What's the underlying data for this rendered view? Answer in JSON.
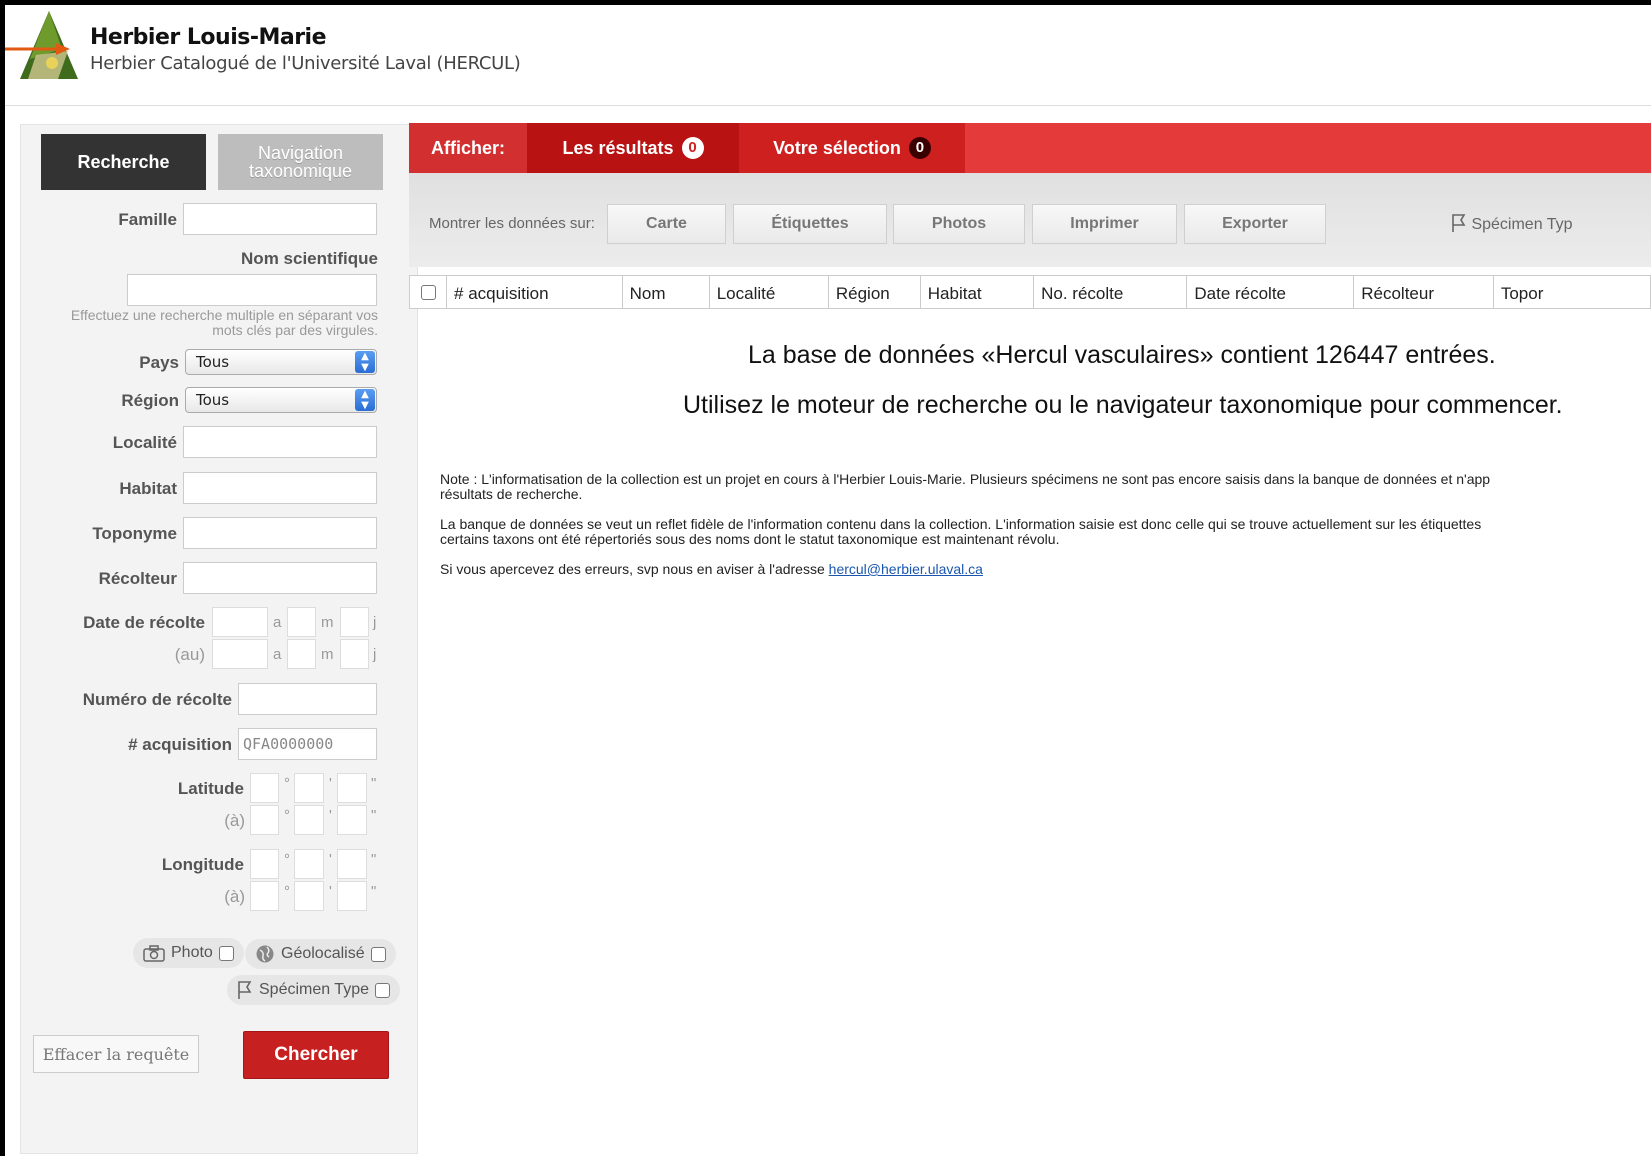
{
  "header": {
    "title": "Herbier Louis-Marie",
    "subtitle": "Herbier Catalogué de l'Université Laval (HERCUL)"
  },
  "sidebar": {
    "tab_search": "Recherche",
    "tab_nav_line1": "Navigation",
    "tab_nav_line2": "taxonomique",
    "famille": "Famille",
    "nom_scientifique": "Nom scientifique",
    "hint_line1": "Effectuez une recherche multiple en séparant vos",
    "hint_line2": "mots clés par des virgules.",
    "pays": "Pays",
    "pays_value": "Tous",
    "region": "Région",
    "region_value": "Tous",
    "localite": "Localité",
    "habitat": "Habitat",
    "toponyme": "Toponyme",
    "recolteur": "Récolteur",
    "date_recolte": "Date de récolte",
    "au": "(au)",
    "unit_a": "a",
    "unit_m": "m",
    "unit_j": "j",
    "numero_recolte": "Numéro de récolte",
    "acquisition": "# acquisition",
    "acquisition_placeholder": "QFA0000000",
    "latitude": "Latitude",
    "longitude": "Longitude",
    "a_accent": "(à)",
    "deg": "°",
    "min": "'",
    "sec": "\"",
    "photo": "Photo",
    "geolocalise": "Géolocalisé",
    "specimen_type": "Spécimen Type",
    "clear_button": "Effacer la requête",
    "search_button": "Chercher"
  },
  "results": {
    "afficher": "Afficher:",
    "tab_results": "Les résultats",
    "tab_results_count": "0",
    "tab_selection": "Votre sélection",
    "tab_selection_count": "0",
    "show_data_on": "Montrer les données sur:",
    "buttons": [
      "Carte",
      "Étiquettes",
      "Photos",
      "Imprimer",
      "Exporter"
    ],
    "specimen_type": "Spécimen Typ",
    "columns": [
      "# acquisition",
      "Nom",
      "Localité",
      "Région",
      "Habitat",
      "No. récolte",
      "Date récolte",
      "Récolteur",
      "Topor"
    ],
    "message1": "La base de données «Hercul vasculaires» contient 126447 entrées.",
    "message2": "Utilisez le moteur de recherche ou le navigateur taxonomique pour commencer.",
    "note1_line1": "Note : L'informatisation de la collection est un projet en cours à l'Herbier Louis-Marie. Plusieurs spécimens ne sont pas encore saisis dans la banque de données et n'app",
    "note1_line2": "résultats de recherche.",
    "note2_line1": "La banque de données se veut un reflet fidèle de l'information contenu dans la collection. L'information saisie est donc celle qui se trouve actuellement sur les étiquettes",
    "note2_line2": "certains taxons ont été répertoriés sous des noms dont le statut taxonomique est maintenant révolu.",
    "note3_text": "Si vous apercevez des erreurs, svp nous en aviser à l'adresse ",
    "note3_email": "hercul@herbier.ulaval.ca"
  },
  "colors": {
    "red": "#e43a3a",
    "dark_red": "#b91212",
    "search_button": "#c62020",
    "link": "#1a56b0"
  }
}
